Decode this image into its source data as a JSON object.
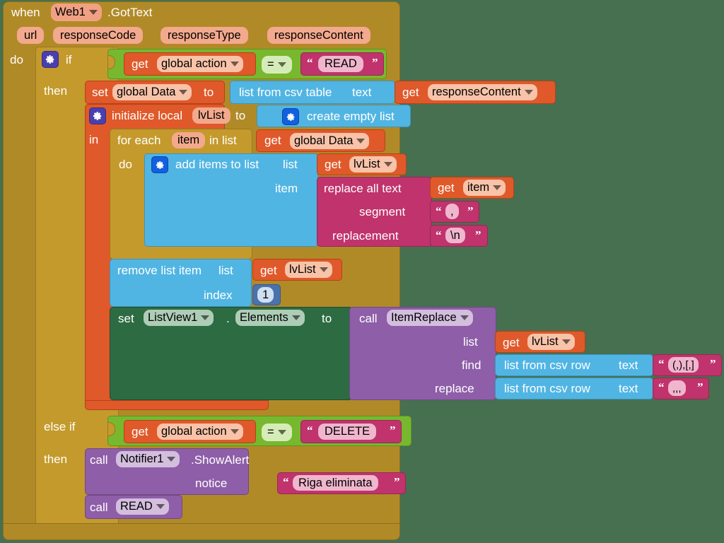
{
  "editor": {
    "name": "MIT App Inventor Blocks Editor",
    "background_color": "#477050"
  },
  "palette": {
    "event": "#b18a28",
    "control": "#c49a2c",
    "logic": "#77b82f",
    "variables": "#e0592a",
    "lists": "#51b5e3",
    "text": "#c0336c",
    "math": "#4a72ab",
    "procedures": "#8e5ea8",
    "component": "#2d6b42"
  },
  "event_block": {
    "when": "when",
    "component": "Web1",
    "event": ".GotText",
    "params": [
      "url",
      "responseCode",
      "responseType",
      "responseContent"
    ],
    "do_label": "do"
  },
  "if_block": {
    "if_label": "if",
    "then_label": "then",
    "else_if_label": "else if",
    "then2_label": "then"
  },
  "condition1": {
    "get_label": "get",
    "variable": "global action",
    "operator": "=",
    "compare_text": "READ"
  },
  "condition2": {
    "get_label": "get",
    "variable": "global action",
    "operator": "=",
    "compare_text": "DELETE"
  },
  "set_global_data": {
    "set_label": "set",
    "variable": "global Data",
    "to_label": "to",
    "value_block": "list from csv table",
    "text_arg_label": "text",
    "get_label": "get",
    "get_variable": "responseContent"
  },
  "init_local": {
    "init_label": "initialize local",
    "name": "lvList",
    "to_label": "to",
    "value_block": "create empty list",
    "in_label": "in"
  },
  "for_each": {
    "for_each_label": "for each",
    "item_name": "item",
    "in_list_label": "in list",
    "get_label": "get",
    "list_variable": "global Data",
    "do_label": "do"
  },
  "add_items": {
    "block_label": "add items to list",
    "list_arg_label": "list",
    "list_get_label": "get",
    "list_variable": "lvList",
    "item_arg_label": "item"
  },
  "replace_all_text": {
    "block_label": "replace all text",
    "text_get_label": "get",
    "text_variable": "item",
    "segment_label": "segment",
    "segment_value": ",",
    "replacement_label": "replacement",
    "replacement_value": "\\n"
  },
  "remove_list_item": {
    "block_label": "remove list item",
    "list_arg_label": "list",
    "get_label": "get",
    "list_variable": "lvList",
    "index_label": "index",
    "index_value": "1"
  },
  "set_listview": {
    "set_label": "set",
    "component": "ListView1",
    "dot": ".",
    "property": "Elements",
    "to_label": "to"
  },
  "call_item_replace": {
    "call_label": "call",
    "procedure": "ItemReplace",
    "list_arg_label": "list",
    "list_get_label": "get",
    "list_variable": "lvList",
    "find_arg_label": "find",
    "find_block": "list from csv row",
    "find_text_label": "text",
    "find_value": "(,),[,]",
    "replace_arg_label": "replace",
    "replace_block": "list from csv row",
    "replace_text_label": "text",
    "replace_value": ",,,"
  },
  "call_notifier": {
    "call_label": "call",
    "component": "Notifier1",
    "method": ".ShowAlert",
    "notice_label": "notice",
    "notice_value": "Riga eliminata"
  },
  "call_read": {
    "call_label": "call",
    "procedure": "READ"
  }
}
